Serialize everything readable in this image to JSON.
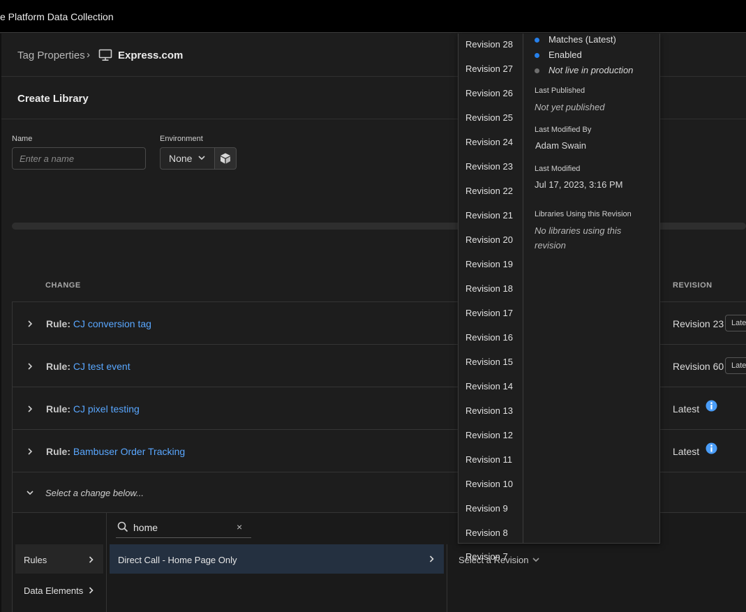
{
  "app": {
    "title": "e Platform Data Collection"
  },
  "breadcrumb": {
    "parent": "Tag Properties",
    "separator": "›",
    "current": "Express.com"
  },
  "page": {
    "title": "Create Library"
  },
  "form": {
    "name_label": "Name",
    "name_placeholder": "Enter a name",
    "name_value": "",
    "environment_label": "Environment",
    "environment_value": "None"
  },
  "table": {
    "headers": {
      "change": "CHANGE",
      "revision": "REVISION"
    },
    "rows": [
      {
        "prefix": "Rule:",
        "name": "CJ conversion tag",
        "revision": "Revision 23",
        "badge": "Latest"
      },
      {
        "prefix": "Rule:",
        "name": "CJ test event",
        "revision": "Revision 60",
        "badge": "Latest"
      },
      {
        "prefix": "Rule:",
        "name": "CJ pixel testing",
        "revision": "Latest",
        "icon": "info-icon"
      },
      {
        "prefix": "Rule:",
        "name": "Bambuser Order Tracking",
        "revision": "Latest",
        "icon": "info-icon"
      }
    ],
    "select_prompt": "Select a change below..."
  },
  "picker": {
    "nav": [
      {
        "label": "Rules"
      },
      {
        "label": "Data Elements"
      }
    ],
    "search_value": "home",
    "clear_glyph": "×",
    "result": "Direct Call - Home Page Only",
    "revision_select": "Select a Revision"
  },
  "revisions": {
    "items": [
      "Revision 28",
      "Revision 27",
      "Revision 26",
      "Revision 25",
      "Revision 24",
      "Revision 23",
      "Revision 22",
      "Revision 21",
      "Revision 20",
      "Revision 19",
      "Revision 18",
      "Revision 17",
      "Revision 16",
      "Revision 15",
      "Revision 14",
      "Revision 13",
      "Revision 12",
      "Revision 11",
      "Revision 10",
      "Revision 9",
      "Revision 8"
    ],
    "overflow_item": "Revision 7"
  },
  "details": {
    "statuses": [
      {
        "text": "Matches (Latest)",
        "color": "#2680eb"
      },
      {
        "text": "Enabled",
        "color": "#2680eb"
      },
      {
        "text": "Not live in production",
        "color": "#6e6e6e"
      }
    ],
    "last_published_label": "Last Published",
    "last_published_value": "Not yet published",
    "last_modified_by_label": "Last Modified By",
    "last_modified_by_value": "Adam Swain",
    "last_modified_label": "Last Modified",
    "last_modified_value": "Jul 17, 2023, 3:16 PM",
    "libraries_label": "Libraries Using this Revision",
    "libraries_value_line1": "No libraries using this",
    "libraries_value_line2": "revision"
  },
  "colors": {
    "link": "#59a7ff",
    "accent": "#2680eb",
    "info": "#4a9df8",
    "selected_row": "#243040"
  }
}
